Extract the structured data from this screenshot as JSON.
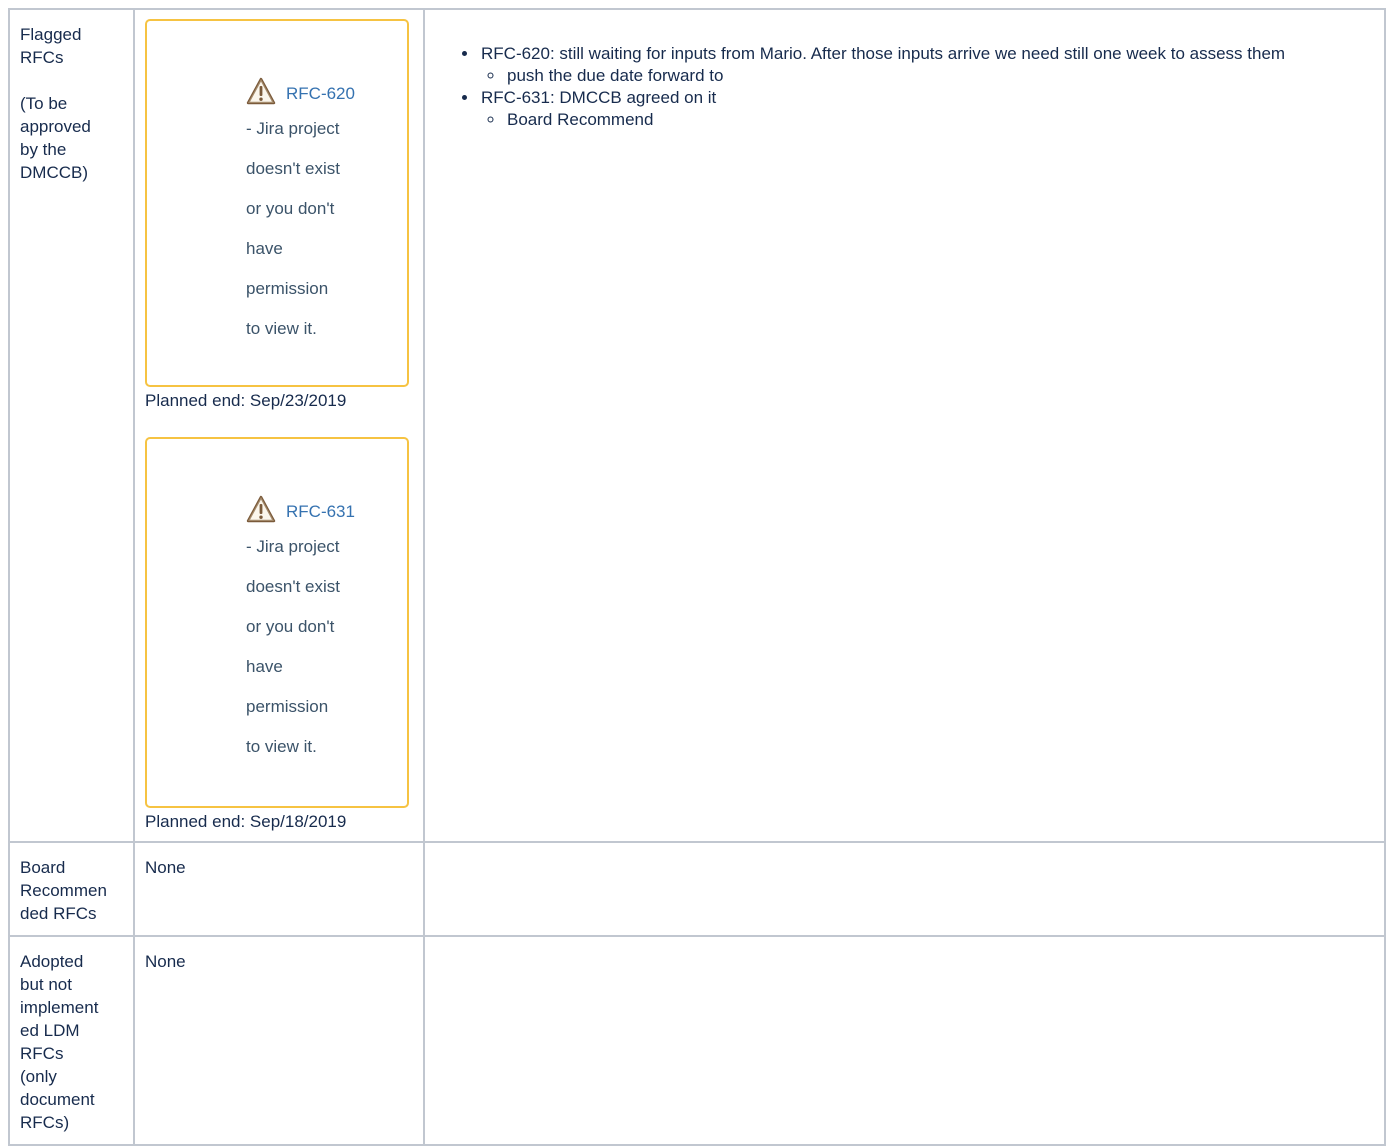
{
  "rows": [
    {
      "label_lines": [
        "Flagged",
        "RFCs",
        "",
        "(To be",
        "approved",
        "by the",
        "DMCCB)"
      ],
      "issues": [
        {
          "key": "RFC-620",
          "message_lines": [
            "- Jira project",
            "doesn't exist",
            "or you don't",
            "have",
            "permission",
            "to view it."
          ],
          "planned_end": "Planned end: Sep/23/2019"
        },
        {
          "key": "RFC-631",
          "message_lines": [
            "- Jira project",
            "doesn't exist",
            "or you don't",
            "have",
            "permission",
            "to view it."
          ],
          "planned_end": "Planned end: Sep/18/2019"
        }
      ],
      "notes": [
        {
          "text": "RFC-620: still waiting for inputs from Mario. After those inputs arrive we need still one week to assess them",
          "sub": [
            "push the due date forward to"
          ]
        },
        {
          "text": "RFC-631: DMCCB agreed on it",
          "sub": [
            "Board Recommend"
          ]
        }
      ]
    },
    {
      "label_lines": [
        "Board",
        "Recommen",
        "ded RFCs"
      ],
      "value": "None"
    },
    {
      "label_lines": [
        "Adopted",
        "but not",
        "implement",
        "ed LDM",
        "RFCs",
        "(only",
        "document",
        "RFCs)"
      ],
      "value": "None"
    }
  ],
  "colors": {
    "border": "#c1c7d0",
    "warning_border": "#f6c342",
    "link": "#3572b0",
    "text": "#172b4d"
  },
  "icons": {
    "warning": "warning-triangle-icon"
  }
}
